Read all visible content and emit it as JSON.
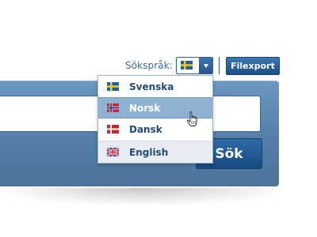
{
  "language_picker": {
    "label": "Sökspråk:",
    "selected_flag": "sweden-flag-icon",
    "arrow_icon": "chevron-down-icon",
    "options": [
      {
        "label": "Svenska",
        "flag": "sweden-flag-icon",
        "state": "normal"
      },
      {
        "label": "Norsk",
        "flag": "norway-flag-icon",
        "state": "hovered"
      },
      {
        "label": "Dansk",
        "flag": "denmark-flag-icon",
        "state": "normal"
      },
      {
        "label": "English",
        "flag": "uk-flag-icon",
        "state": "normal"
      }
    ]
  },
  "export": {
    "label": "Filexport"
  },
  "search": {
    "input_value": "",
    "placeholder": "",
    "button_label": "Sök"
  },
  "cursor": {
    "type": "hand-pointer-icon"
  },
  "colors": {
    "panel": "#5a86ae",
    "button": "#1d5189",
    "option_text": "#234a72",
    "option_highlight": "#8fb2d3",
    "label_text": "#3e6a95"
  }
}
